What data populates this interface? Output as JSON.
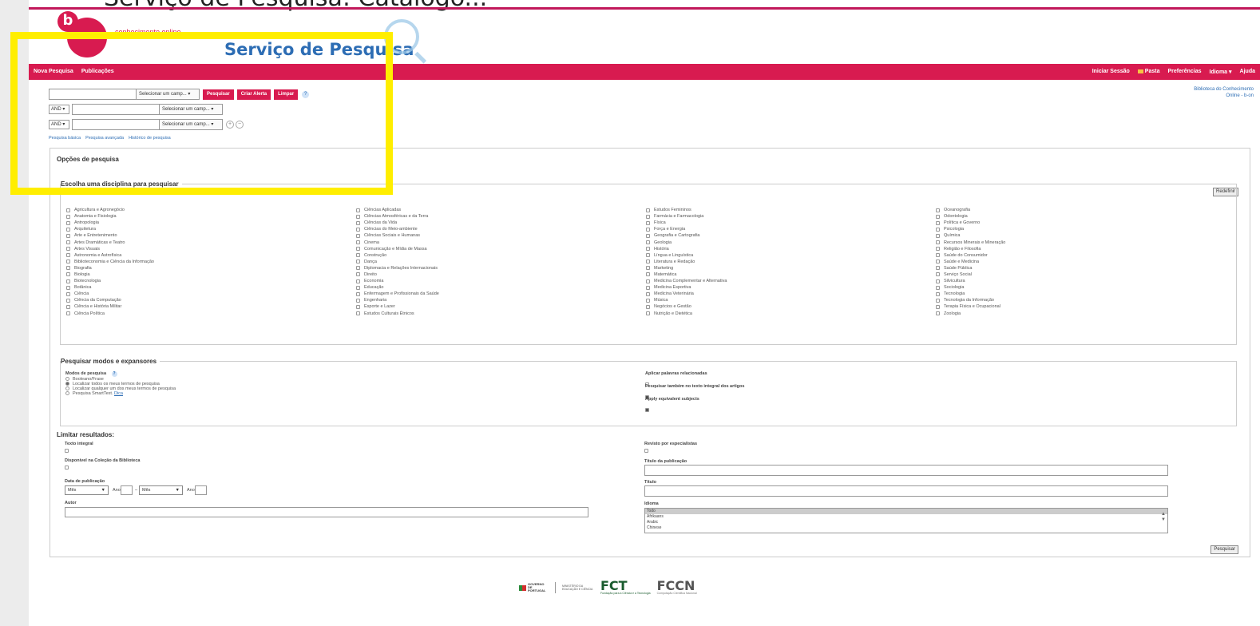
{
  "top_partial_text": "Serviço de Pesquisa: Catálogo...",
  "header": {
    "logo_letter": "b",
    "logo_tagline": "conhecimento online",
    "service_title": "Serviço de Pesquisa"
  },
  "nav": {
    "left": [
      "Nova Pesquisa",
      "Publicações"
    ],
    "right": [
      "Iniciar Sessão",
      "Pasta",
      "Preferências",
      "Idioma ▾",
      "Ajuda"
    ]
  },
  "library": {
    "line1": "Biblioteca do Conhecimento",
    "line2": "Online - b-on"
  },
  "search": {
    "field_placeholder": "Selecionar um camp...",
    "bool_value": "AND",
    "buttons": {
      "search": "Pesquisar",
      "alert": "Criar Alerta",
      "clear": "Limpar"
    },
    "help": "?",
    "links": [
      "Pesquisa básica",
      "Pesquisa avançada",
      "Histórico de pesquisa"
    ]
  },
  "options": {
    "title": "Opções de pesquisa",
    "reset": "Redefinir",
    "discipline_title": "Escolha uma disciplina para pesquisar",
    "disciplines": [
      [
        "Agricultura e Agronegócio",
        "Anatomia e Fisiologia",
        "Antropologia",
        "Arquitetura",
        "Arte e Entretenimento",
        "Artes Dramáticas e Teatro",
        "Artes Visuais",
        "Astronomia e Astrofísica",
        "Biblioteconomia e Ciência da Informação",
        "Biografia",
        "Biologia",
        "Biotecnologia",
        "Botânica",
        "Ciência",
        "Ciência da Computação",
        "Ciência e História Militar",
        "Ciência Política"
      ],
      [
        "Ciências Aplicadas",
        "Ciências Atmosféricas e da Terra",
        "Ciências da Vida",
        "Ciências do Meio-ambiente",
        "Ciências Sociais e Humanas",
        "Cinema",
        "Comunicação e Mídia de Massa",
        "Construção",
        "Dança",
        "Diplomacia e Relações Internacionais",
        "Direito",
        "Economia",
        "Educação",
        "Enfermagem e Profissionais da Saúde",
        "Engenharia",
        "Esporte e Lazer",
        "Estudos Culturais Étnicos"
      ],
      [
        "Estudos Femininos",
        "Farmácia e Farmacologia",
        "Física",
        "Força e Energia",
        "Geografia e Cartografia",
        "Geologia",
        "História",
        "Língua e Linguística",
        "Literatura e Redação",
        "Marketing",
        "Matemática",
        "Medicina Complementar e Alternativa",
        "Medicina Esportiva",
        "Medicina Veterinária",
        "Música",
        "Negócios e Gestão",
        "Nutrição e Dietética"
      ],
      [
        "Oceanografia",
        "Odontologia",
        "Política e Governo",
        "Psicologia",
        "Química",
        "Recursos Minerais e Mineração",
        "Religião e Filosofia",
        "Saúde do Consumidor",
        "Saúde e Medicina",
        "Saúde Pública",
        "Serviço Social",
        "Silvicultura",
        "Sociologia",
        "Tecnologia",
        "Tecnologia da Informação",
        "Terapia Física e Ocupacional",
        "Zoologia"
      ]
    ],
    "modes_title": "Pesquisar modos e expansores",
    "modes_label": "Modos de pesquisa",
    "modes": [
      "Booleano/Frase",
      "Localizar todos os meus termos de pesquisa",
      "Localizar qualquer um dos meus termos de pesquisa",
      "Pesquisa SmartText."
    ],
    "modes_hint": "Dica",
    "expanders": [
      "Aplicar palavras relacionadas",
      "Pesquisar também no texto integral dos artigos",
      "Apply equivalent subjects"
    ],
    "limit_title": "Limitar resultados:",
    "limits": {
      "full_text": "Texto integral",
      "peer_reviewed": "Revisto por especialistas",
      "library_collection": "Disponível na Coleção da Biblioteca",
      "publication_title": "Título da publicação",
      "pub_date": "Data de publicação",
      "month_value": "Mês",
      "year_label": "Ano:",
      "title": "Título",
      "author": "Autor",
      "language": "Idioma"
    },
    "languages": [
      "Todo",
      "Afrikaans",
      "Arabic",
      "Chinese"
    ],
    "search_button": "Pesquisar"
  },
  "footer": {
    "gov": "GOVERNO DE PORTUGAL",
    "ministry": "MINISTÉRIO DA EDUCAÇÃO E CIÊNCIA",
    "fct": "FCT",
    "fct_sub": "Fundação para a Ciência e a Tecnologia",
    "fccn": "FCCN",
    "fccn_sub": "Computação Científica Nacional"
  }
}
